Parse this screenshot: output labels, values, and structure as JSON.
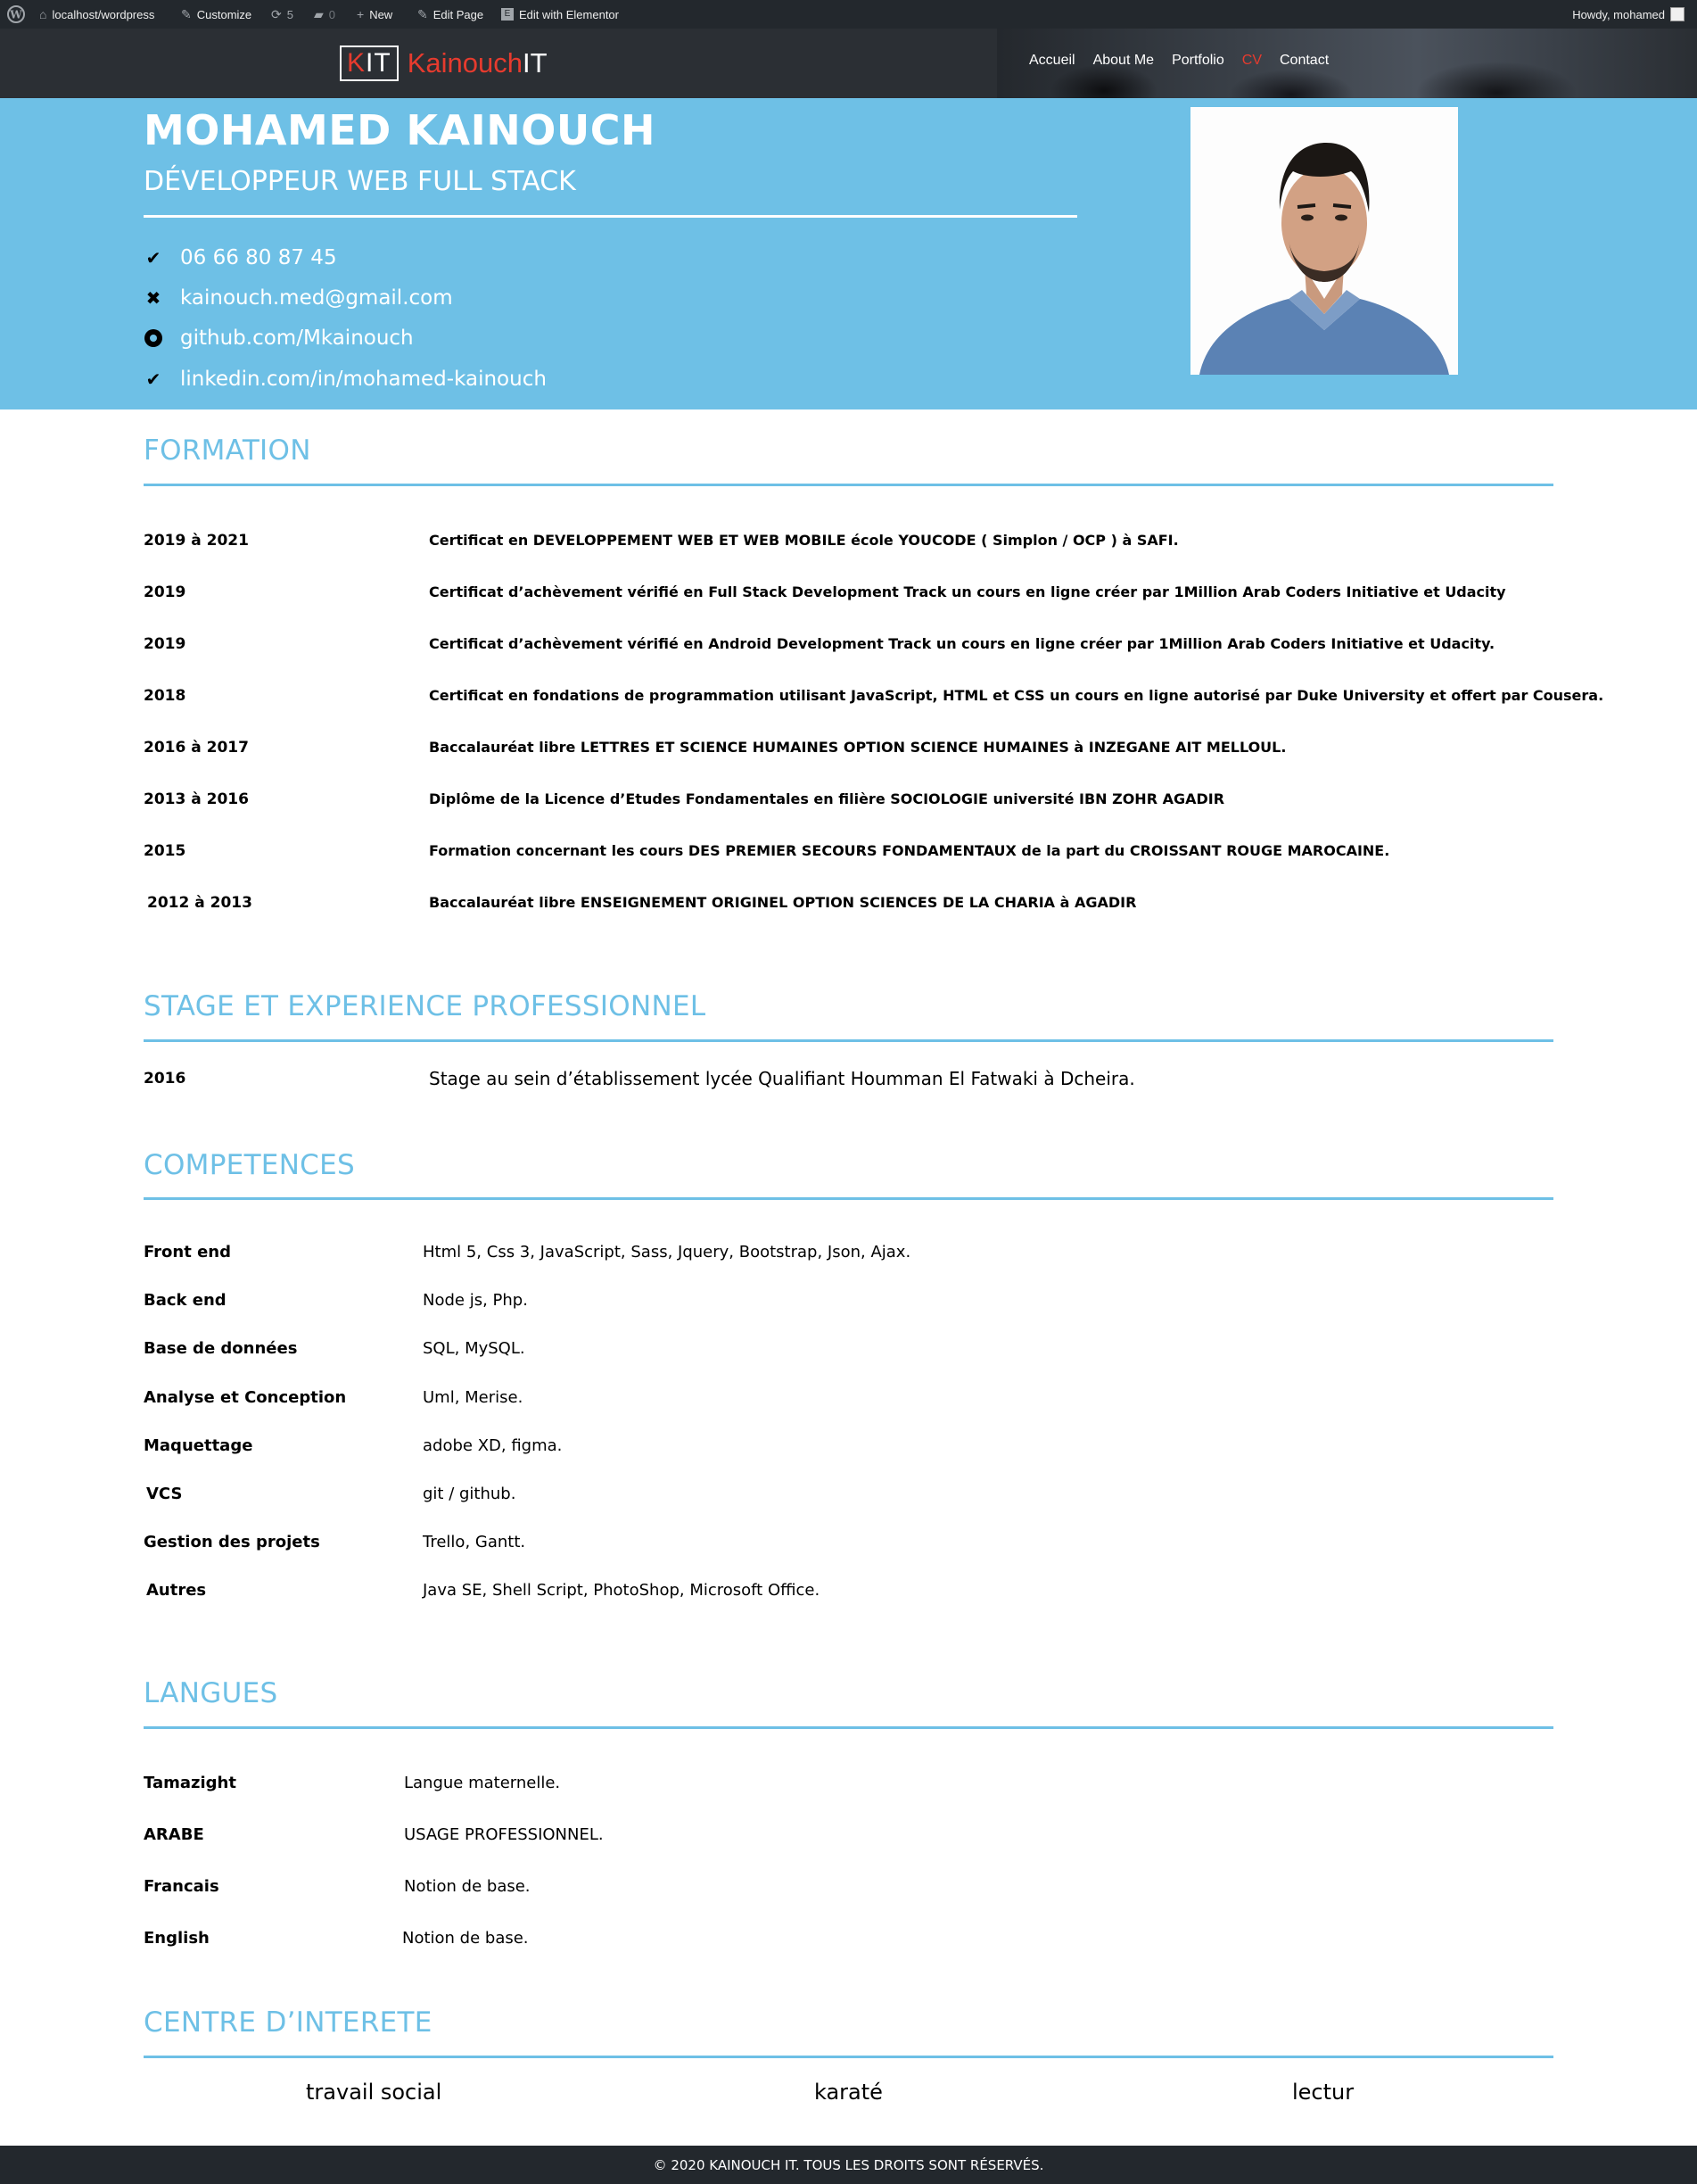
{
  "admin_bar": {
    "site": "localhost/wordpress",
    "customize": "Customize",
    "updates_count": "5",
    "comments_count": "0",
    "new": "New",
    "edit_page": "Edit Page",
    "edit_elementor": "Edit with Elementor",
    "howdy": "Howdy, mohamed"
  },
  "header": {
    "logo_box": [
      "K",
      "IT"
    ],
    "logo_name": [
      "Kainouch",
      "IT"
    ],
    "menu": [
      "Accueil",
      "About Me",
      "Portfolio",
      "CV",
      "Contact"
    ],
    "active_item": "CV",
    "accent_color": "#e63b2e"
  },
  "hero": {
    "name": "MOHAMED KAINOUCH",
    "title": "DÉVELOPPEUR WEB FULL STACK",
    "background": "#6ec0e6",
    "contacts": [
      {
        "icon": "check-icon",
        "text": "06 66 80 87 45"
      },
      {
        "icon": "close-icon",
        "text": "kainouch.med@gmail.com"
      },
      {
        "icon": "dot-circle-icon",
        "text": "github.com/Mkainouch"
      },
      {
        "icon": "check-icon",
        "text": "linkedin.com/in/mohamed-kainouch"
      }
    ]
  },
  "formation": {
    "title": "FORMATION",
    "rows": [
      {
        "date": "2019 à 2021",
        "text": "Certificat en DEVELOPPEMENT WEB ET WEB MOBILE école YOUCODE ( Simplon / OCP ) à  SAFI."
      },
      {
        "date": "2019",
        "text": "Certificat d’achèvement vérifié en Full Stack Development Track un cours en ligne créer par 1Million Arab Coders Initiative et Udacity"
      },
      {
        "date": "2019",
        "text": "Certificat d’achèvement vérifié en Android Development Track un cours en ligne créer par 1Million Arab Coders Initiative et Udacity."
      },
      {
        "date": "2018",
        "text": "Certificat en fondations de programmation utilisant JavaScript, HTML et CSS un cours en ligne autorisé par Duke University et offert par Cousera."
      },
      {
        "date": "2016 à 2017",
        "text": "Baccalauréat libre LETTRES ET SCIENCE HUMAINES OPTION SCIENCE HUMAINES  à  INZEGANE  AIT MELLOUL."
      },
      {
        "date": "2013 à 2016",
        "text": "Diplôme de la Licence d’Etudes Fondamentales en filière SOCIOLOGIE université IBN ZOHR AGADIR"
      },
      {
        "date": "2015",
        "text": "Formation concernant les cours DES PREMIER SECOURS FONDAMENTAUX de la part du CROISSANT ROUGE MAROCAINE."
      },
      {
        "date": " 2012 à 2013",
        "text": "Baccalauréat libre ENSEIGNEMENT ORIGINEL OPTION SCIENCES DE LA CHARIA  à  AGADIR"
      }
    ]
  },
  "stage": {
    "title": "STAGE ET EXPERIENCE PROFESSIONNEL",
    "rows": [
      {
        "date": "2016",
        "text": "Stage au sein d’établissement lycée Qualifiant Houmman El Fatwaki à Dcheira."
      }
    ]
  },
  "competences": {
    "title": "COMPETENCES",
    "rows": [
      {
        "label": "Front end",
        "value": "Html 5, Css 3, JavaScript, Sass, Jquery, Bootstrap, Json, Ajax."
      },
      {
        "label": "Back end",
        "value": "Node js, Php."
      },
      {
        "label": "Base de données",
        "value": "SQL, MySQL."
      },
      {
        "label": "Analyse et Conception",
        "value": "Uml, Merise."
      },
      {
        "label": "Maquettage",
        "value": " adobe XD, figma."
      },
      {
        "label": " VCS",
        "value": "  git / github."
      },
      {
        "label": "Gestion des projets",
        "value": " Trello, Gantt."
      },
      {
        "label": " Autres",
        "value": "  Java SE, Shell Script, PhotoShop, Microsoft Office."
      }
    ]
  },
  "langues": {
    "title": "LANGUES",
    "rows": [
      {
        "label": "Tamazight",
        "value": "Langue maternelle."
      },
      {
        "label": "ARABE",
        "value": "USAGE PROFESSIONNEL."
      },
      {
        "label": "Francais",
        "value": "Notion de base."
      },
      {
        "label": "English",
        "value": "Notion de base."
      }
    ]
  },
  "interets": {
    "title": "CENTRE D’INTERETE",
    "items": [
      "travail social",
      "karaté",
      "lectur"
    ]
  },
  "footer": {
    "text": "© 2020 KAINOUCH IT. TOUS LES DROITS SONT RÉSERVÉS."
  }
}
